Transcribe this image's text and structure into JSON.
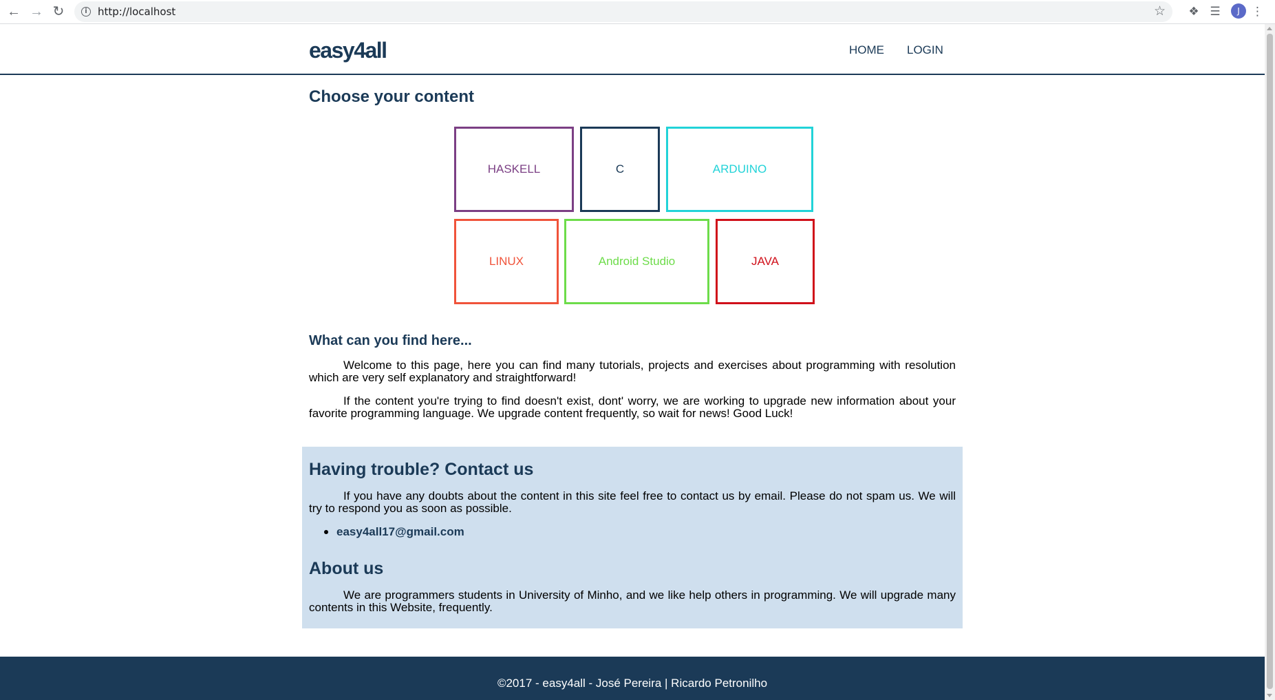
{
  "browser": {
    "url": "http://localhost",
    "profile_initial": "J"
  },
  "header": {
    "logo": "easy4all",
    "nav": [
      {
        "label": "HOME"
      },
      {
        "label": "LOGIN"
      }
    ]
  },
  "main": {
    "title": "Choose your content",
    "tiles": [
      {
        "label": "HASKELL",
        "color": "#7b3f84"
      },
      {
        "label": "C",
        "color": "#1b3a57"
      },
      {
        "label": "ARDUINO",
        "color": "#22d3d8"
      },
      {
        "label": "LINUX",
        "color": "#f0533a"
      },
      {
        "label": "Android Studio",
        "color": "#6ddc4a"
      },
      {
        "label": "JAVA",
        "color": "#d0101a"
      }
    ],
    "about_heading": "What can you find here...",
    "paragraphs": [
      "Welcome to this page, here you can find many tutorials, projects and exercises about programming with resolution which are very self explanatory and straightforward!",
      "If the content you're trying to find doesn't exist, dont' worry, we are working to upgrade new information about your favorite programming language. We upgrade content frequently, so wait for news! Good Luck!"
    ]
  },
  "contact": {
    "heading": "Having trouble? Contact us",
    "text": "If you have any doubts about the content in this site feel free to contact us by email. Please do not spam us. We will try to respond you as soon as possible.",
    "email": "easy4all17@gmail.com",
    "about_heading": "About us",
    "about_text": "We are programmers students in University of Minho, and we like help others in programming. We will upgrade many contents in this Website, frequently."
  },
  "footer": {
    "copyright": "©2017 - easy4all - José Pereira | Ricardo Petronilho"
  },
  "colors": {
    "brand": "#1b3a57",
    "contact_bg": "#cfdfee"
  }
}
